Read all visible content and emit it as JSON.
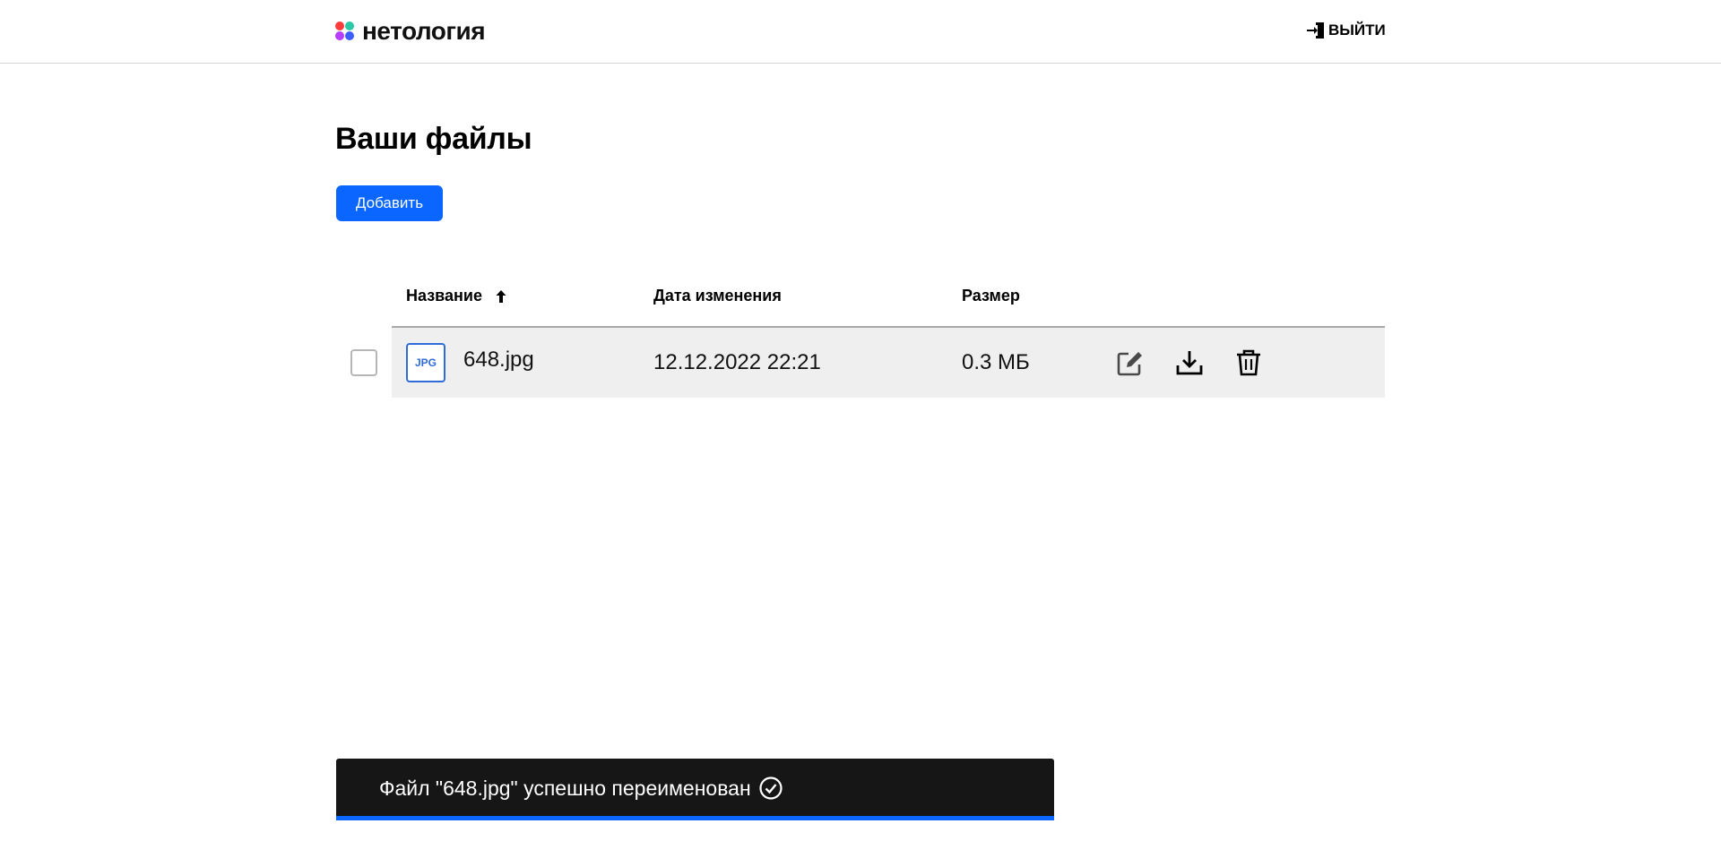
{
  "header": {
    "logo_text": "нетология",
    "logout_label": "ВЫЙТИ",
    "logo_colors": [
      "#ff3c3c",
      "#2bc9a6",
      "#3c5dff",
      "#b63cff"
    ]
  },
  "main": {
    "title": "Ваши файлы",
    "add_button_label": "Добавить",
    "columns": {
      "name": "Название",
      "modified": "Дата изменения",
      "size": "Размер"
    },
    "sort": {
      "column": "name",
      "direction": "ascending",
      "icon": "arrow-up-icon"
    },
    "files": [
      {
        "type_badge": "JPG",
        "name": "648.jpg",
        "modified": "12.12.2022 22:21",
        "size": "0.3 МБ",
        "selected": false,
        "actions": [
          "edit-icon",
          "download-icon",
          "trash-icon"
        ]
      }
    ]
  },
  "toast": {
    "message": "Файл \"648.jpg\" успешно переименован",
    "icon": "check-circle-icon",
    "accent_color": "#0a66ff"
  },
  "colors": {
    "accent": "#0a66ff",
    "file_badge": "#2f6cd8",
    "row_background": "#efefef",
    "toast_background": "#161616"
  }
}
